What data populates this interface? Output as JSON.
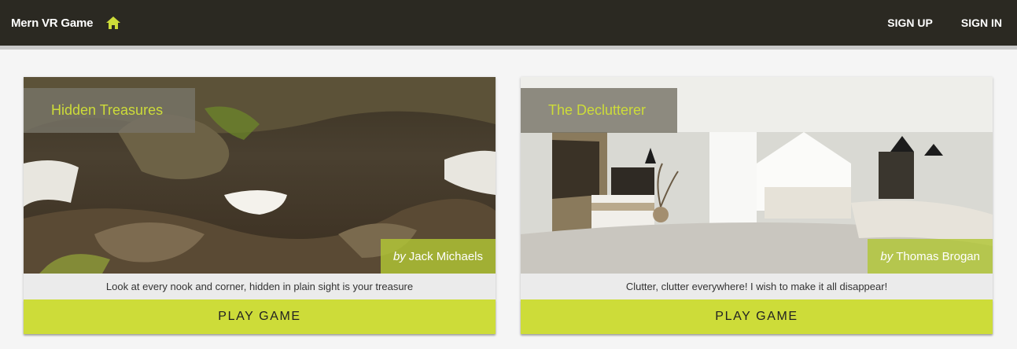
{
  "appbar": {
    "title": "Mern VR Game",
    "home_icon": "home-icon",
    "signup_label": "SIGN UP",
    "signin_label": "SIGN IN"
  },
  "colors": {
    "appbar_bg": "#2b2922",
    "accent": "#cddc39",
    "page_bg": "#f5f5f5"
  },
  "games": [
    {
      "name": "Hidden Treasures",
      "by_prefix": "by",
      "maker": "Jack Michaels",
      "description": "Look at every nook and corner, hidden in plain sight is your treasure",
      "play_label": "PLAY GAME"
    },
    {
      "name": "The Declutterer",
      "by_prefix": "by",
      "maker": "Thomas Brogan",
      "description": "Clutter, clutter everywhere! I wish to make it all disappear!",
      "play_label": "PLAY GAME"
    }
  ]
}
